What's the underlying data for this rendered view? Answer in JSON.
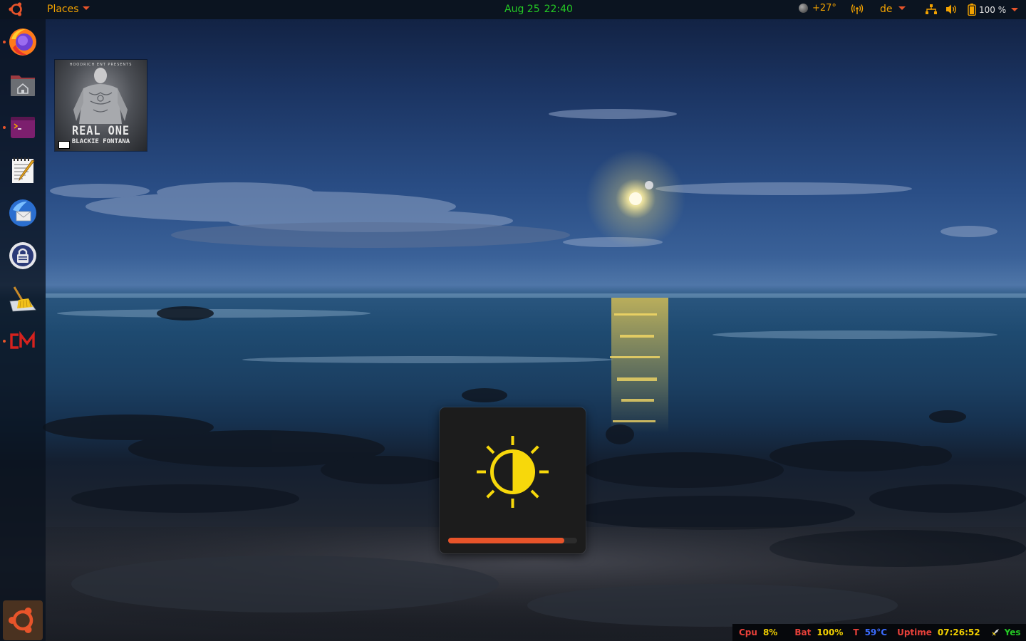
{
  "top_panel": {
    "menu_label": "Places",
    "date": "Aug 25",
    "time": "22:40",
    "weather": "+27°",
    "keyboard_layout": "de",
    "battery": "100 %"
  },
  "dock": {
    "apps": [
      {
        "name": "firefox-icon",
        "running": true
      },
      {
        "name": "home-folder-icon",
        "running": false
      },
      {
        "name": "terminal-icon",
        "running": true
      },
      {
        "name": "text-editor-icon",
        "running": false
      },
      {
        "name": "thunderbird-icon",
        "running": false
      },
      {
        "name": "keepassxc-icon",
        "running": false
      },
      {
        "name": "bleachbit-icon",
        "running": false
      },
      {
        "name": "cm-app-icon",
        "running": true
      }
    ]
  },
  "desktop_file": {
    "top_text": "HOODRICH ENT PRESENTS",
    "title": "REAL ONE",
    "subtitle": "BLACKIE FONTANA"
  },
  "osd": {
    "brightness_level": 0.9,
    "accent": "#e8542a",
    "icon": "brightness-icon",
    "icon_color": "#f7d80b"
  },
  "conky": {
    "cpu_label": "Cpu",
    "cpu_value": "8%",
    "bat_label": "Bat",
    "bat_value": "100%",
    "temp_label": "T",
    "temp_value": "59°C",
    "uptime_label": "Uptime",
    "uptime_value": "07:26:52",
    "status_value": "Yes"
  },
  "colors": {
    "accent_orange": "#e8542a",
    "panel_text_orange": "#f2a200",
    "clock_green": "#24c924"
  }
}
